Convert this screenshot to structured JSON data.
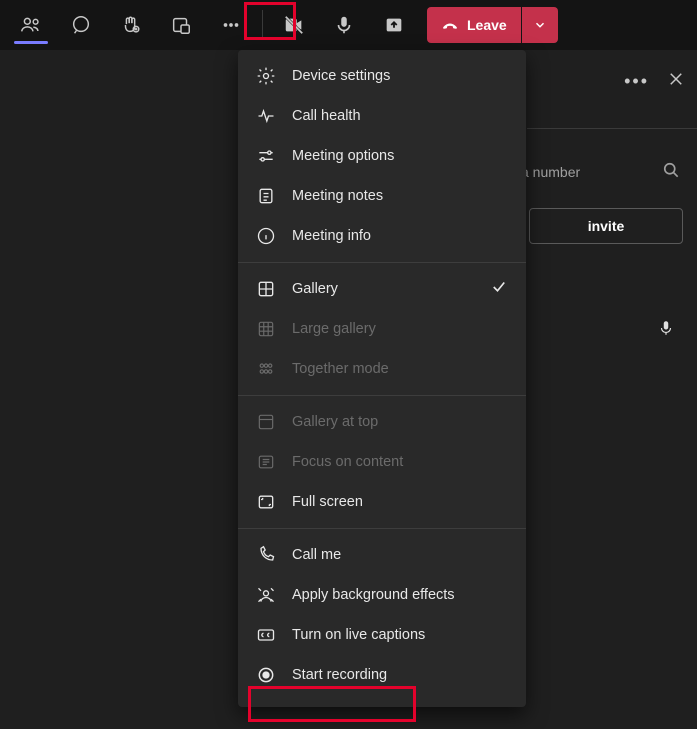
{
  "topbar": {
    "leave_label": "Leave"
  },
  "panel": {
    "search_placeholder": "a number",
    "invite_label": "invite"
  },
  "menu": {
    "section1": [
      {
        "id": "device-settings",
        "label": "Device settings"
      },
      {
        "id": "call-health",
        "label": "Call health"
      },
      {
        "id": "meeting-options",
        "label": "Meeting options"
      },
      {
        "id": "meeting-notes",
        "label": "Meeting notes"
      },
      {
        "id": "meeting-info",
        "label": "Meeting info"
      }
    ],
    "section2": [
      {
        "id": "gallery",
        "label": "Gallery",
        "checked": true
      },
      {
        "id": "large-gallery",
        "label": "Large gallery",
        "disabled": true
      },
      {
        "id": "together-mode",
        "label": "Together mode",
        "disabled": true
      }
    ],
    "section3": [
      {
        "id": "gallery-at-top",
        "label": "Gallery at top",
        "disabled": true
      },
      {
        "id": "focus-on-content",
        "label": "Focus on content",
        "disabled": true
      },
      {
        "id": "full-screen",
        "label": "Full screen"
      }
    ],
    "section4": [
      {
        "id": "call-me",
        "label": "Call me"
      },
      {
        "id": "apply-background-effects",
        "label": "Apply background effects"
      },
      {
        "id": "turn-on-live-captions",
        "label": "Turn on live captions"
      },
      {
        "id": "start-recording",
        "label": "Start recording"
      }
    ]
  }
}
